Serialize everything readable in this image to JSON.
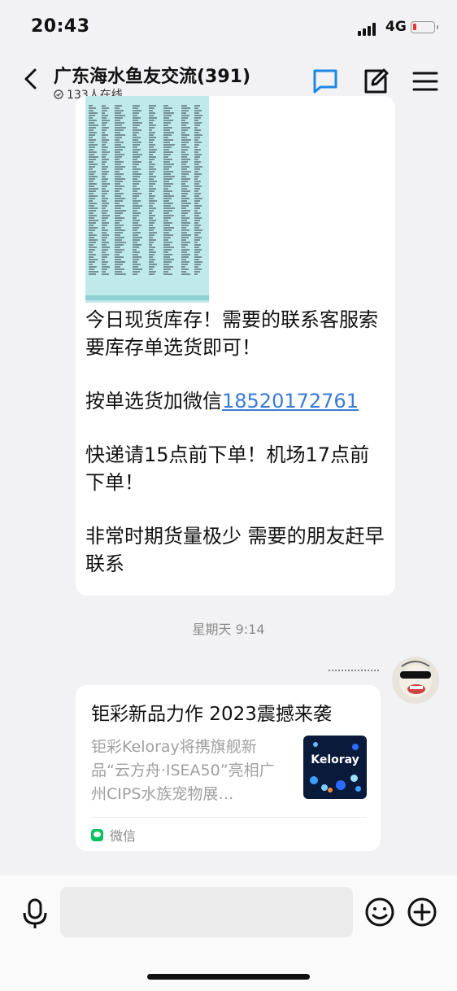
{
  "status_bar": {
    "time": "20:43",
    "network": "4G",
    "battery_level": 0.15,
    "battery_color": "#e53935"
  },
  "header": {
    "title": "广东海水鱼友交流(391)",
    "online": "133人在线",
    "back_icon": "chevron-left-icon",
    "chat_icon": "chat-bubble-icon",
    "edit_icon": "edit-icon",
    "menu_icon": "hamburger-menu-icon",
    "accent": "#1e88e5"
  },
  "messages": {
    "m1": {
      "line1": "今日现货库存！需要的联系客服索要库存单选货即可！",
      "line2_prefix": "按单选货加微信",
      "line2_link": "18520172761",
      "line3": "快递请15点前下单！机场17点前下单！",
      "line4": "非常时期货量极少 需要的朋友赶早联系"
    },
    "timestamp": "星期天 9:14",
    "card": {
      "title": "钜彩新品力作 2023震撼来袭",
      "description": "钜彩Keloray将携旗舰新品“云方舟·ISEA50”亮相广州CIPS水族宠物展…",
      "thumb_text": "Keloray",
      "source": "微信"
    }
  },
  "input": {
    "mic_icon": "microphone-icon",
    "emoji_icon": "emoji-icon",
    "plus_icon": "plus-circle-icon"
  }
}
